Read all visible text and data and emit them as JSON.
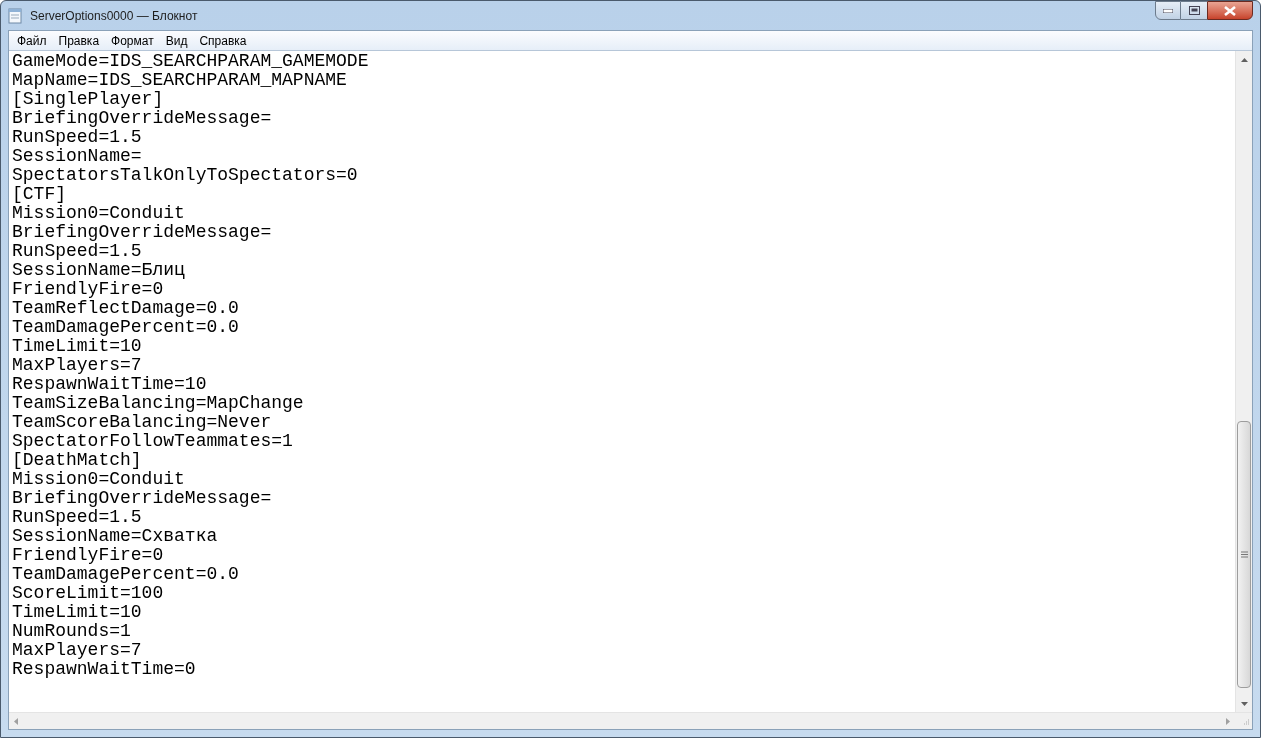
{
  "window": {
    "title": "ServerOptions0000 — Блокнот"
  },
  "menu": [
    "Файл",
    "Правка",
    "Формат",
    "Вид",
    "Справка"
  ],
  "lines": [
    "GameMode=IDS_SEARCHPARAM_GAMEMODE",
    "MapName=IDS_SEARCHPARAM_MAPNAME",
    "[SinglePlayer]",
    "BriefingOverrideMessage=",
    "RunSpeed=1.5",
    "SessionName=",
    "SpectatorsTalkOnlyToSpectators=0",
    "[CTF]",
    "Mission0=Conduit",
    "BriefingOverrideMessage=",
    "RunSpeed=1.5",
    "SessionName=Блиц",
    "FriendlyFire=0",
    "TeamReflectDamage=0.0",
    "TeamDamagePercent=0.0",
    "TimeLimit=10",
    "MaxPlayers=7",
    "RespawnWaitTime=10",
    "TeamSizeBalancing=MapChange",
    "TeamScoreBalancing=Never",
    "SpectatorFollowTeammates=1",
    "[DeathMatch]",
    "Mission0=Conduit",
    "BriefingOverrideMessage=",
    "RunSpeed=1.5",
    "SessionName=Схватка",
    "FriendlyFire=0",
    "TeamDamagePercent=0.0",
    "ScoreLimit=100",
    "TimeLimit=10",
    "NumRounds=1",
    "MaxPlayers=7",
    "RespawnWaitTime=0"
  ]
}
